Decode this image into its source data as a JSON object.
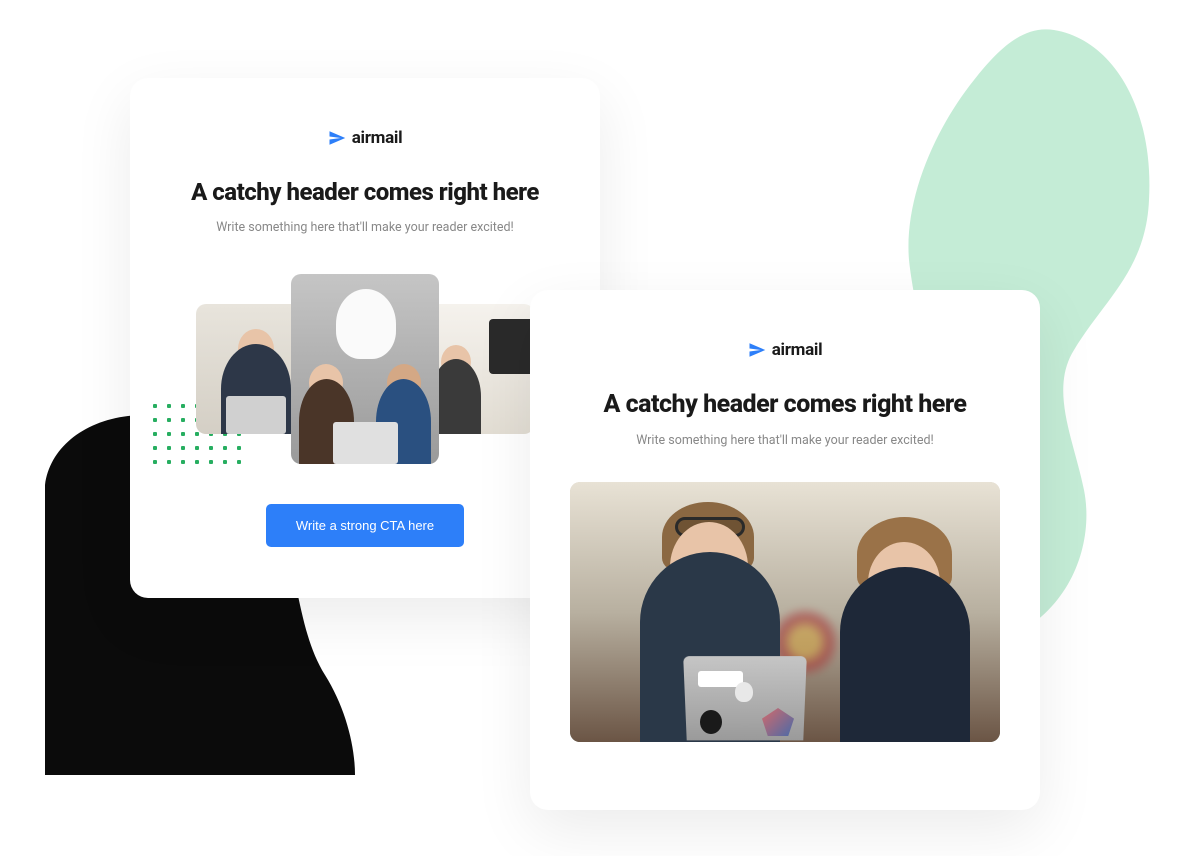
{
  "brand": {
    "name": "airmail",
    "accent_color": "#2d7ff9"
  },
  "card_left": {
    "header": "A catchy header comes right here",
    "subheader": "Write something here that'll make your reader excited!",
    "cta_label": "Write a strong CTA here"
  },
  "card_right": {
    "header": "A catchy header comes right here",
    "subheader": "Write something here that'll make your reader excited!"
  },
  "decorative": {
    "green_blob_color": "#c4ecd6",
    "black_blob_color": "#0b0b0b",
    "dot_color": "#27ae60"
  }
}
